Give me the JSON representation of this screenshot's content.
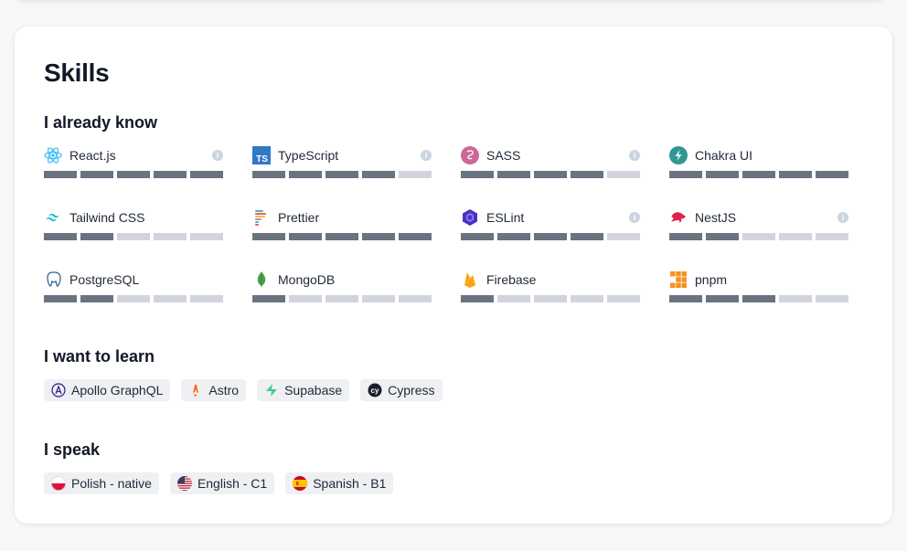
{
  "section": {
    "title": "Skills"
  },
  "known": {
    "heading": "I already know",
    "skills": [
      {
        "name": "React.js",
        "icon": "react-icon",
        "level": 5,
        "info": true
      },
      {
        "name": "TypeScript",
        "icon": "typescript-icon",
        "level": 4,
        "info": true
      },
      {
        "name": "SASS",
        "icon": "sass-icon",
        "level": 4,
        "info": true
      },
      {
        "name": "Chakra UI",
        "icon": "chakra-icon",
        "level": 5,
        "info": false
      },
      {
        "name": "Tailwind CSS",
        "icon": "tailwind-icon",
        "level": 2,
        "info": false
      },
      {
        "name": "Prettier",
        "icon": "prettier-icon",
        "level": 5,
        "info": false
      },
      {
        "name": "ESLint",
        "icon": "eslint-icon",
        "level": 4,
        "info": true
      },
      {
        "name": "NestJS",
        "icon": "nestjs-icon",
        "level": 2,
        "info": true
      },
      {
        "name": "PostgreSQL",
        "icon": "postgresql-icon",
        "level": 2,
        "info": false
      },
      {
        "name": "MongoDB",
        "icon": "mongodb-icon",
        "level": 1,
        "info": false
      },
      {
        "name": "Firebase",
        "icon": "firebase-icon",
        "level": 1,
        "info": false
      },
      {
        "name": "pnpm",
        "icon": "pnpm-icon",
        "level": 3,
        "info": false
      }
    ],
    "max_level": 5
  },
  "learn": {
    "heading": "I want to learn",
    "tags": [
      {
        "label": "Apollo GraphQL",
        "icon": "apollo-icon"
      },
      {
        "label": "Astro",
        "icon": "astro-icon"
      },
      {
        "label": "Supabase",
        "icon": "supabase-icon"
      },
      {
        "label": "Cypress",
        "icon": "cypress-icon"
      }
    ]
  },
  "speak": {
    "heading": "I speak",
    "tags": [
      {
        "label": "Polish - native",
        "icon": "poland-flag-icon"
      },
      {
        "label": "English - C1",
        "icon": "usa-flag-icon"
      },
      {
        "label": "Spanish - B1",
        "icon": "spain-flag-icon"
      }
    ]
  },
  "colors": {
    "bar_filled": "#6b7280",
    "bar_empty": "#d1d5db",
    "tag_bg": "#eef0f3"
  }
}
